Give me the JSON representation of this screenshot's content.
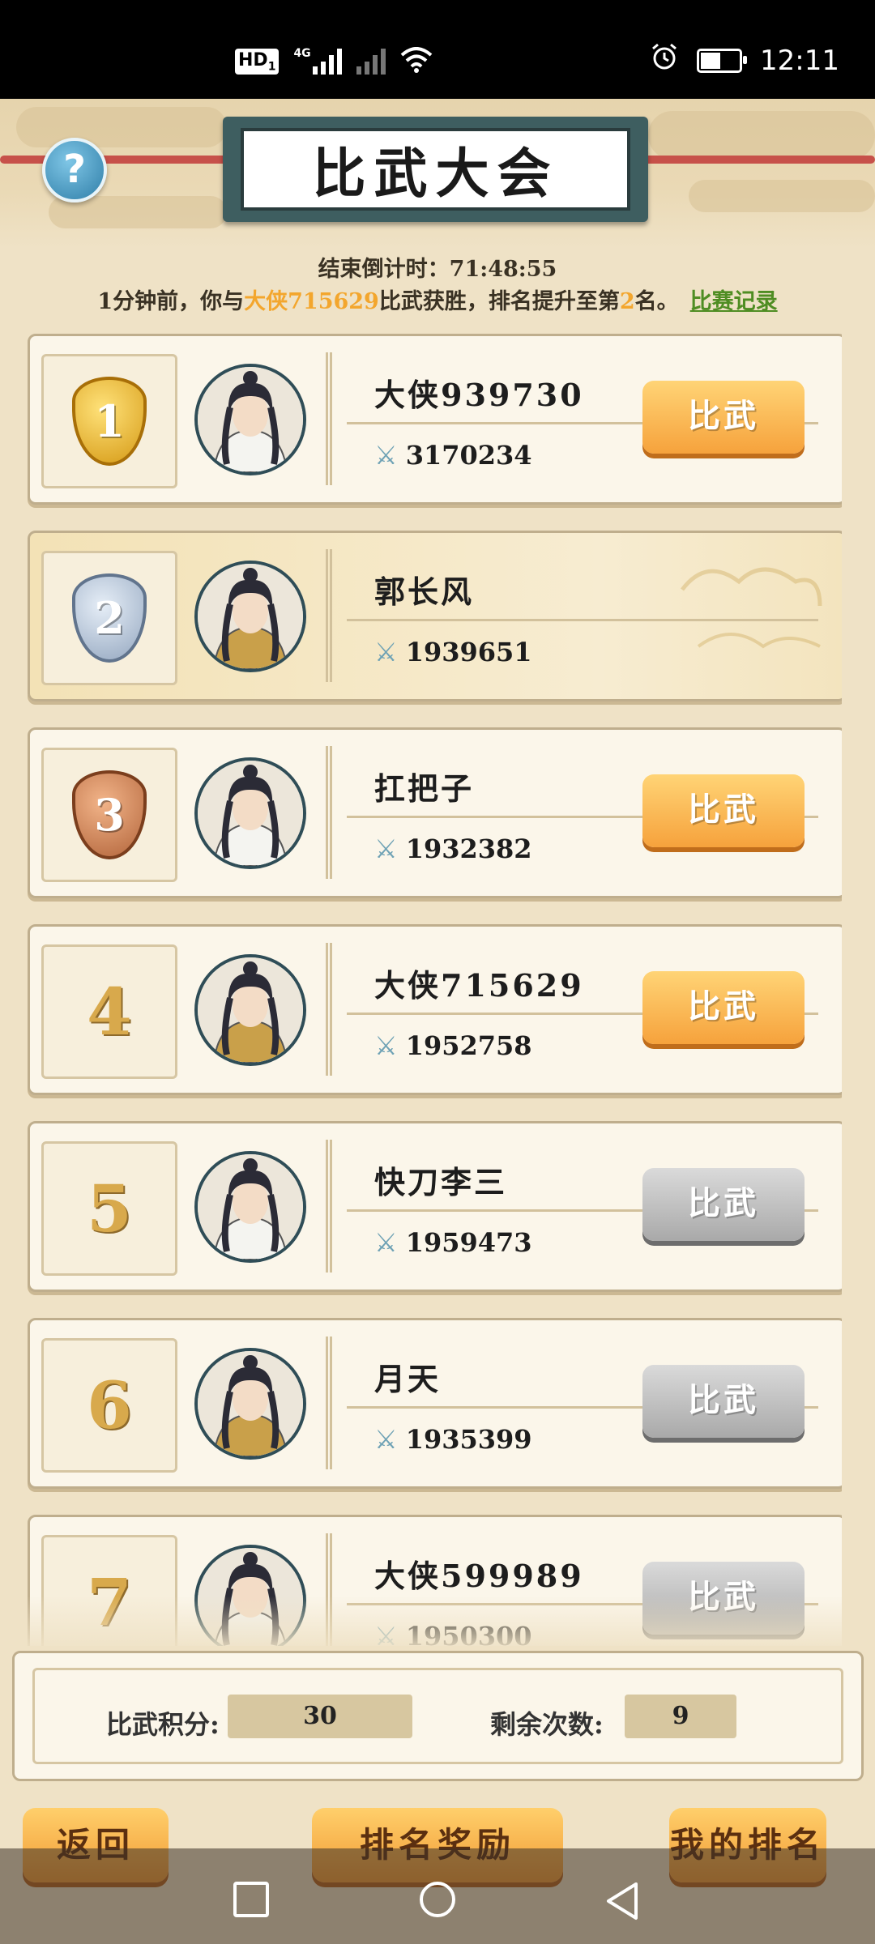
{
  "status_bar": {
    "hd_badge": "HD",
    "sim": "1",
    "network": "4G",
    "time": "12:11",
    "battery_level": 0.55,
    "icons": [
      "hd-icon",
      "signal-icon",
      "signal-icon",
      "wifi-icon",
      "alarm-icon",
      "battery-icon"
    ]
  },
  "header": {
    "title": "比武大会",
    "help_icon": "?"
  },
  "countdown": {
    "label": "结束倒计时：",
    "value": "71:48:55"
  },
  "notice": {
    "part1": "1分钟前，你与",
    "opponent": "大侠715629",
    "part2": "比武获胜，排名提升至第",
    "rank": "2",
    "part3": "名。",
    "link": "比赛记录"
  },
  "ranking": [
    {
      "rank": "1",
      "medal": "gold",
      "name": "大侠939730",
      "power": "3170234",
      "button": "比武",
      "button_state": "orange",
      "is_me": false
    },
    {
      "rank": "2",
      "medal": "silver",
      "name": "郭长风",
      "power": "1939651",
      "button": "",
      "button_state": "none",
      "is_me": true
    },
    {
      "rank": "3",
      "medal": "bronze",
      "name": "扛把子",
      "power": "1932382",
      "button": "比武",
      "button_state": "orange",
      "is_me": false
    },
    {
      "rank": "4",
      "medal": "",
      "name": "大侠715629",
      "power": "1952758",
      "button": "比武",
      "button_state": "orange",
      "is_me": false
    },
    {
      "rank": "5",
      "medal": "",
      "name": "快刀李三",
      "power": "1959473",
      "button": "比武",
      "button_state": "gray",
      "is_me": false
    },
    {
      "rank": "6",
      "medal": "",
      "name": "月天",
      "power": "1935399",
      "button": "比武",
      "button_state": "gray",
      "is_me": false
    },
    {
      "rank": "7",
      "medal": "",
      "name": "大侠599989",
      "power": "1950300",
      "button": "比武",
      "button_state": "gray",
      "is_me": false
    }
  ],
  "score_panel": {
    "points_label": "比武积分:",
    "points_value": "30",
    "remaining_label": "剩余次数:",
    "remaining_value": "9"
  },
  "bottom_buttons": {
    "back": "返回",
    "rewards": "排名奖励",
    "my_rank": "我的排名"
  },
  "navbar_icons": [
    "square-icon",
    "circle-icon",
    "back-triangle-icon"
  ]
}
